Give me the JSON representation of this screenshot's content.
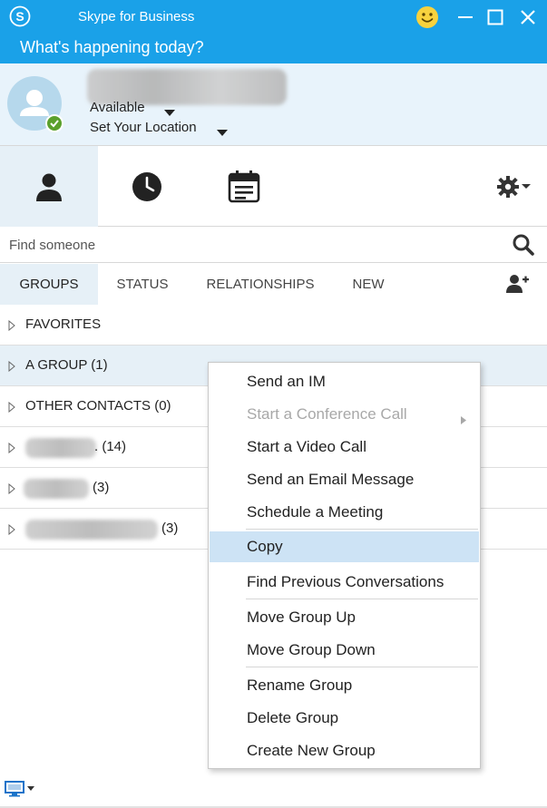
{
  "window": {
    "title": "Skype for Business",
    "accent": "#1aa1e8"
  },
  "banner": {
    "text": "What's happening today?"
  },
  "profile": {
    "status": "Available",
    "location": "Set Your Location",
    "presence_color": "#5aa02c"
  },
  "nav": {
    "tabs": [
      "contacts",
      "conversations",
      "meetings"
    ],
    "options_icon": "gear-icon"
  },
  "search": {
    "placeholder": "Find someone"
  },
  "filters": {
    "groups": "GROUPS",
    "status": "STATUS",
    "relationships": "RELATIONSHIPS",
    "new": "NEW"
  },
  "groups": [
    {
      "label": "FAVORITES",
      "count": ""
    },
    {
      "label": "A GROUP (1)",
      "count": ""
    },
    {
      "label": "OTHER CONTACTS (0)",
      "count": ""
    },
    {
      "label": "",
      "count": ". (14)"
    },
    {
      "label": "",
      "count": "(3)"
    },
    {
      "label": "",
      "count": "(3)"
    }
  ],
  "context_menu": {
    "items": [
      {
        "text": "Send an IM",
        "disabled": false
      },
      {
        "text": "Start a Conference Call",
        "disabled": true,
        "submenu": true
      },
      {
        "text": "Start a Video Call",
        "disabled": false
      },
      {
        "text": "Send an Email Message",
        "disabled": false
      },
      {
        "text": "Schedule a Meeting",
        "disabled": false
      },
      {
        "text": "Copy",
        "disabled": false,
        "highlighted": true
      },
      {
        "text": "Find Previous Conversations",
        "disabled": false
      },
      {
        "text": "Move Group Up",
        "disabled": false
      },
      {
        "text": "Move Group Down",
        "disabled": false
      },
      {
        "text": "Rename Group",
        "disabled": false
      },
      {
        "text": "Delete Group",
        "disabled": false
      },
      {
        "text": "Create New Group",
        "disabled": false
      }
    ]
  }
}
